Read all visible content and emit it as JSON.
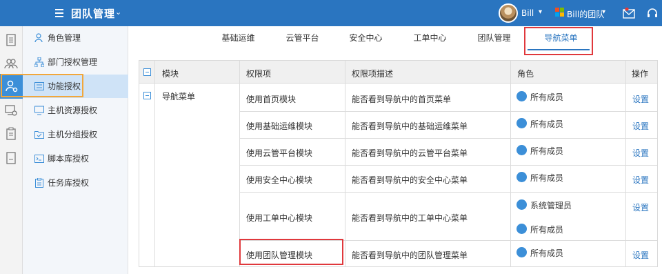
{
  "header": {
    "title": "团队管理",
    "user": "Bill",
    "team": "Bill的团队",
    "colors": {
      "bar": "#2a75c0"
    },
    "icons": [
      "menu-icon",
      "avatar",
      "mail-icon",
      "headset-icon"
    ]
  },
  "sidebar": {
    "items": [
      {
        "label": "角色管理",
        "icon": "user-role-icon"
      },
      {
        "label": "部门授权管理",
        "icon": "org-chart-icon"
      },
      {
        "label": "功能授权",
        "icon": "function-icon",
        "active": true
      },
      {
        "label": "主机资源授权",
        "icon": "monitor-icon"
      },
      {
        "label": "主机分组授权",
        "icon": "folder-icon"
      },
      {
        "label": "脚本库授权",
        "icon": "script-icon"
      },
      {
        "label": "任务库授权",
        "icon": "task-icon"
      }
    ]
  },
  "tabs": [
    "基础运维",
    "云管平台",
    "安全中心",
    "工单中心",
    "团队管理",
    "导航菜单"
  ],
  "active_tab": "导航菜单",
  "table": {
    "headers": {
      "module": "模块",
      "permission": "权限项",
      "description": "权限项描述",
      "role": "角色",
      "action": "操作"
    },
    "module": "导航菜单",
    "rows": [
      {
        "permission": "使用首页模块",
        "description": "能否看到导航中的首页菜单",
        "roles": [
          "所有成员"
        ],
        "action": "设置"
      },
      {
        "permission": "使用基础运维模块",
        "description": "能否看到导航中的基础运维菜单",
        "roles": [
          "所有成员"
        ],
        "action": "设置"
      },
      {
        "permission": "使用云管平台模块",
        "description": "能否看到导航中的云管平台菜单",
        "roles": [
          "所有成员"
        ],
        "action": "设置"
      },
      {
        "permission": "使用安全中心模块",
        "description": "能否看到导航中的安全中心菜单",
        "roles": [
          "所有成员"
        ],
        "action": "设置"
      },
      {
        "permission": "使用工单中心模块",
        "description": "能否看到导航中的工单中心菜单",
        "roles": [
          "系统管理员",
          "所有成员"
        ],
        "action": "设置"
      },
      {
        "permission": "使用团队管理模块",
        "description": "能否看到导航中的团队管理菜单",
        "roles": [
          "所有成员"
        ],
        "action": "设置"
      }
    ]
  }
}
